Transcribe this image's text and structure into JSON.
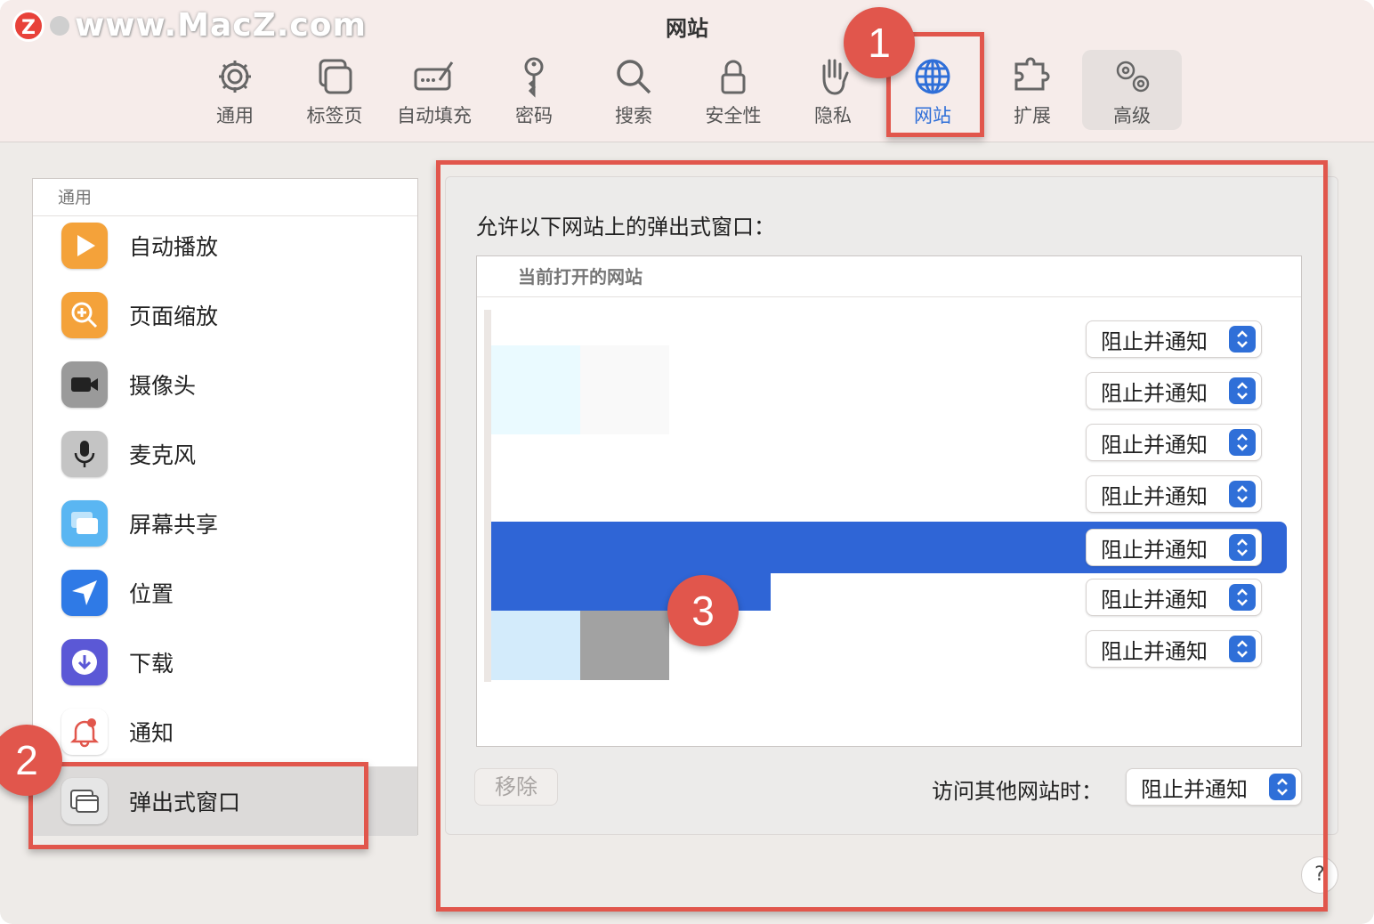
{
  "window": {
    "title": "网站"
  },
  "watermark": {
    "logo": "Z",
    "text": "www.MacZ.com"
  },
  "toolbar": {
    "tabs": [
      {
        "label": "通用",
        "icon": "gear-icon"
      },
      {
        "label": "标签页",
        "icon": "tabs-icon"
      },
      {
        "label": "自动填充",
        "icon": "autofill-icon"
      },
      {
        "label": "密码",
        "icon": "key-icon"
      },
      {
        "label": "搜索",
        "icon": "search-icon"
      },
      {
        "label": "安全性",
        "icon": "lock-icon"
      },
      {
        "label": "隐私",
        "icon": "hand-icon"
      },
      {
        "label": "网站",
        "icon": "globe-icon",
        "active": true
      },
      {
        "label": "扩展",
        "icon": "puzzle-icon"
      },
      {
        "label": "高级",
        "icon": "gears-icon"
      }
    ]
  },
  "annotations": {
    "badge1": "1",
    "badge2": "2",
    "badge3": "3"
  },
  "sidebar": {
    "header": "通用",
    "items": [
      {
        "label": "自动播放",
        "icon": "play-icon",
        "color": "#f4a23a"
      },
      {
        "label": "页面缩放",
        "icon": "zoom-icon",
        "color": "#f4a23a"
      },
      {
        "label": "摄像头",
        "icon": "camera-icon",
        "color": "#8d8d8d"
      },
      {
        "label": "麦克风",
        "icon": "microphone-icon",
        "color": "#b9b9b9"
      },
      {
        "label": "屏幕共享",
        "icon": "screen-share-icon",
        "color": "#5ab6f2"
      },
      {
        "label": "位置",
        "icon": "location-icon",
        "color": "#2f7ae6"
      },
      {
        "label": "下载",
        "icon": "download-icon",
        "color": "#5b58d6"
      },
      {
        "label": "通知",
        "icon": "bell-icon",
        "color": "#ffffff"
      },
      {
        "label": "弹出式窗口",
        "icon": "popup-window-icon",
        "color": "#d8d8d8",
        "selected": true
      }
    ]
  },
  "main": {
    "title": "允许以下网站上的弹出式窗口：",
    "table_header": "当前打开的网站",
    "rows": [
      {
        "value": "阻止并通知"
      },
      {
        "value": "阻止并通知"
      },
      {
        "value": "阻止并通知"
      },
      {
        "value": "阻止并通知"
      },
      {
        "value": "阻止并通知",
        "selected": true
      },
      {
        "value": "阻止并通知"
      },
      {
        "value": "阻止并通知"
      }
    ],
    "remove_button": "移除",
    "other_sites_label": "访问其他网站时：",
    "other_sites_value": "阻止并通知"
  },
  "help": "?",
  "colors": {
    "accent": "#2f6fd8",
    "annotation": "#e1564c",
    "selection": "#2f65d6"
  }
}
